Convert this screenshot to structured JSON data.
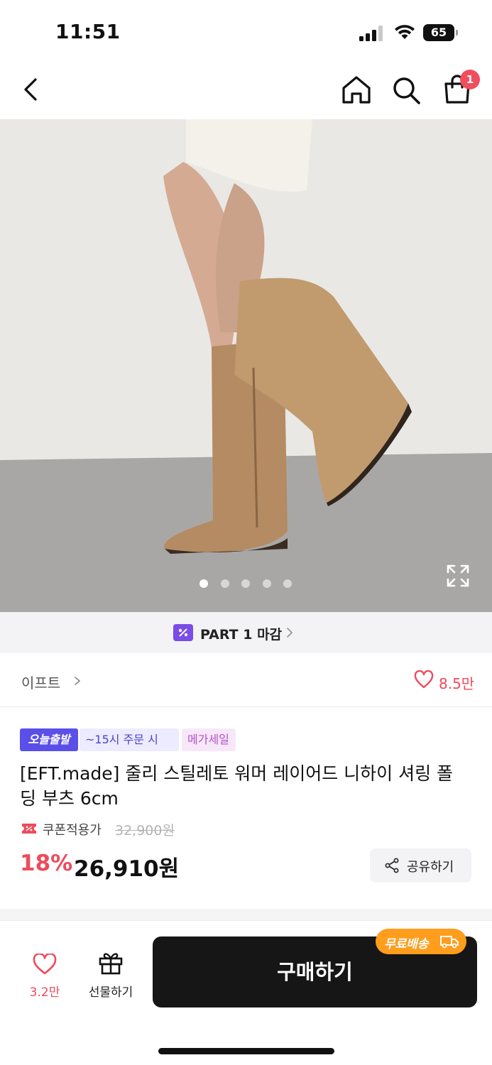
{
  "status_bar": {
    "time": "11:51",
    "battery": "65"
  },
  "nav": {
    "cart_count": "1"
  },
  "gallery": {
    "total_images": 5,
    "active_index": 0
  },
  "part_banner": {
    "text": "PART 1 마감",
    "badge_color": "#7b4ce6"
  },
  "brand": {
    "name": "이프트",
    "likes": "8.5만"
  },
  "product": {
    "tags": [
      "오늘출발",
      "~15시 주문 시",
      "메가세일"
    ],
    "title": "[EFT.made] 줄리 스틸레토 워머 레이어드 니하이 셔링 폴딩 부츠 6cm",
    "coupon_label": "쿠폰적용가",
    "original_price": "32,900원",
    "discount": "18%",
    "price": "26,910원",
    "share_label": "공유하기"
  },
  "bottom_bar": {
    "wish_count": "3.2만",
    "gift_label": "선물하기",
    "buy_label": "구매하기",
    "free_shipping_label": "무료배송"
  },
  "colors": {
    "accent_red": "#ee4b5c",
    "today_tag": "#5a4fe8",
    "free_ship": "#ff9d1d",
    "buy_button": "#161616"
  }
}
